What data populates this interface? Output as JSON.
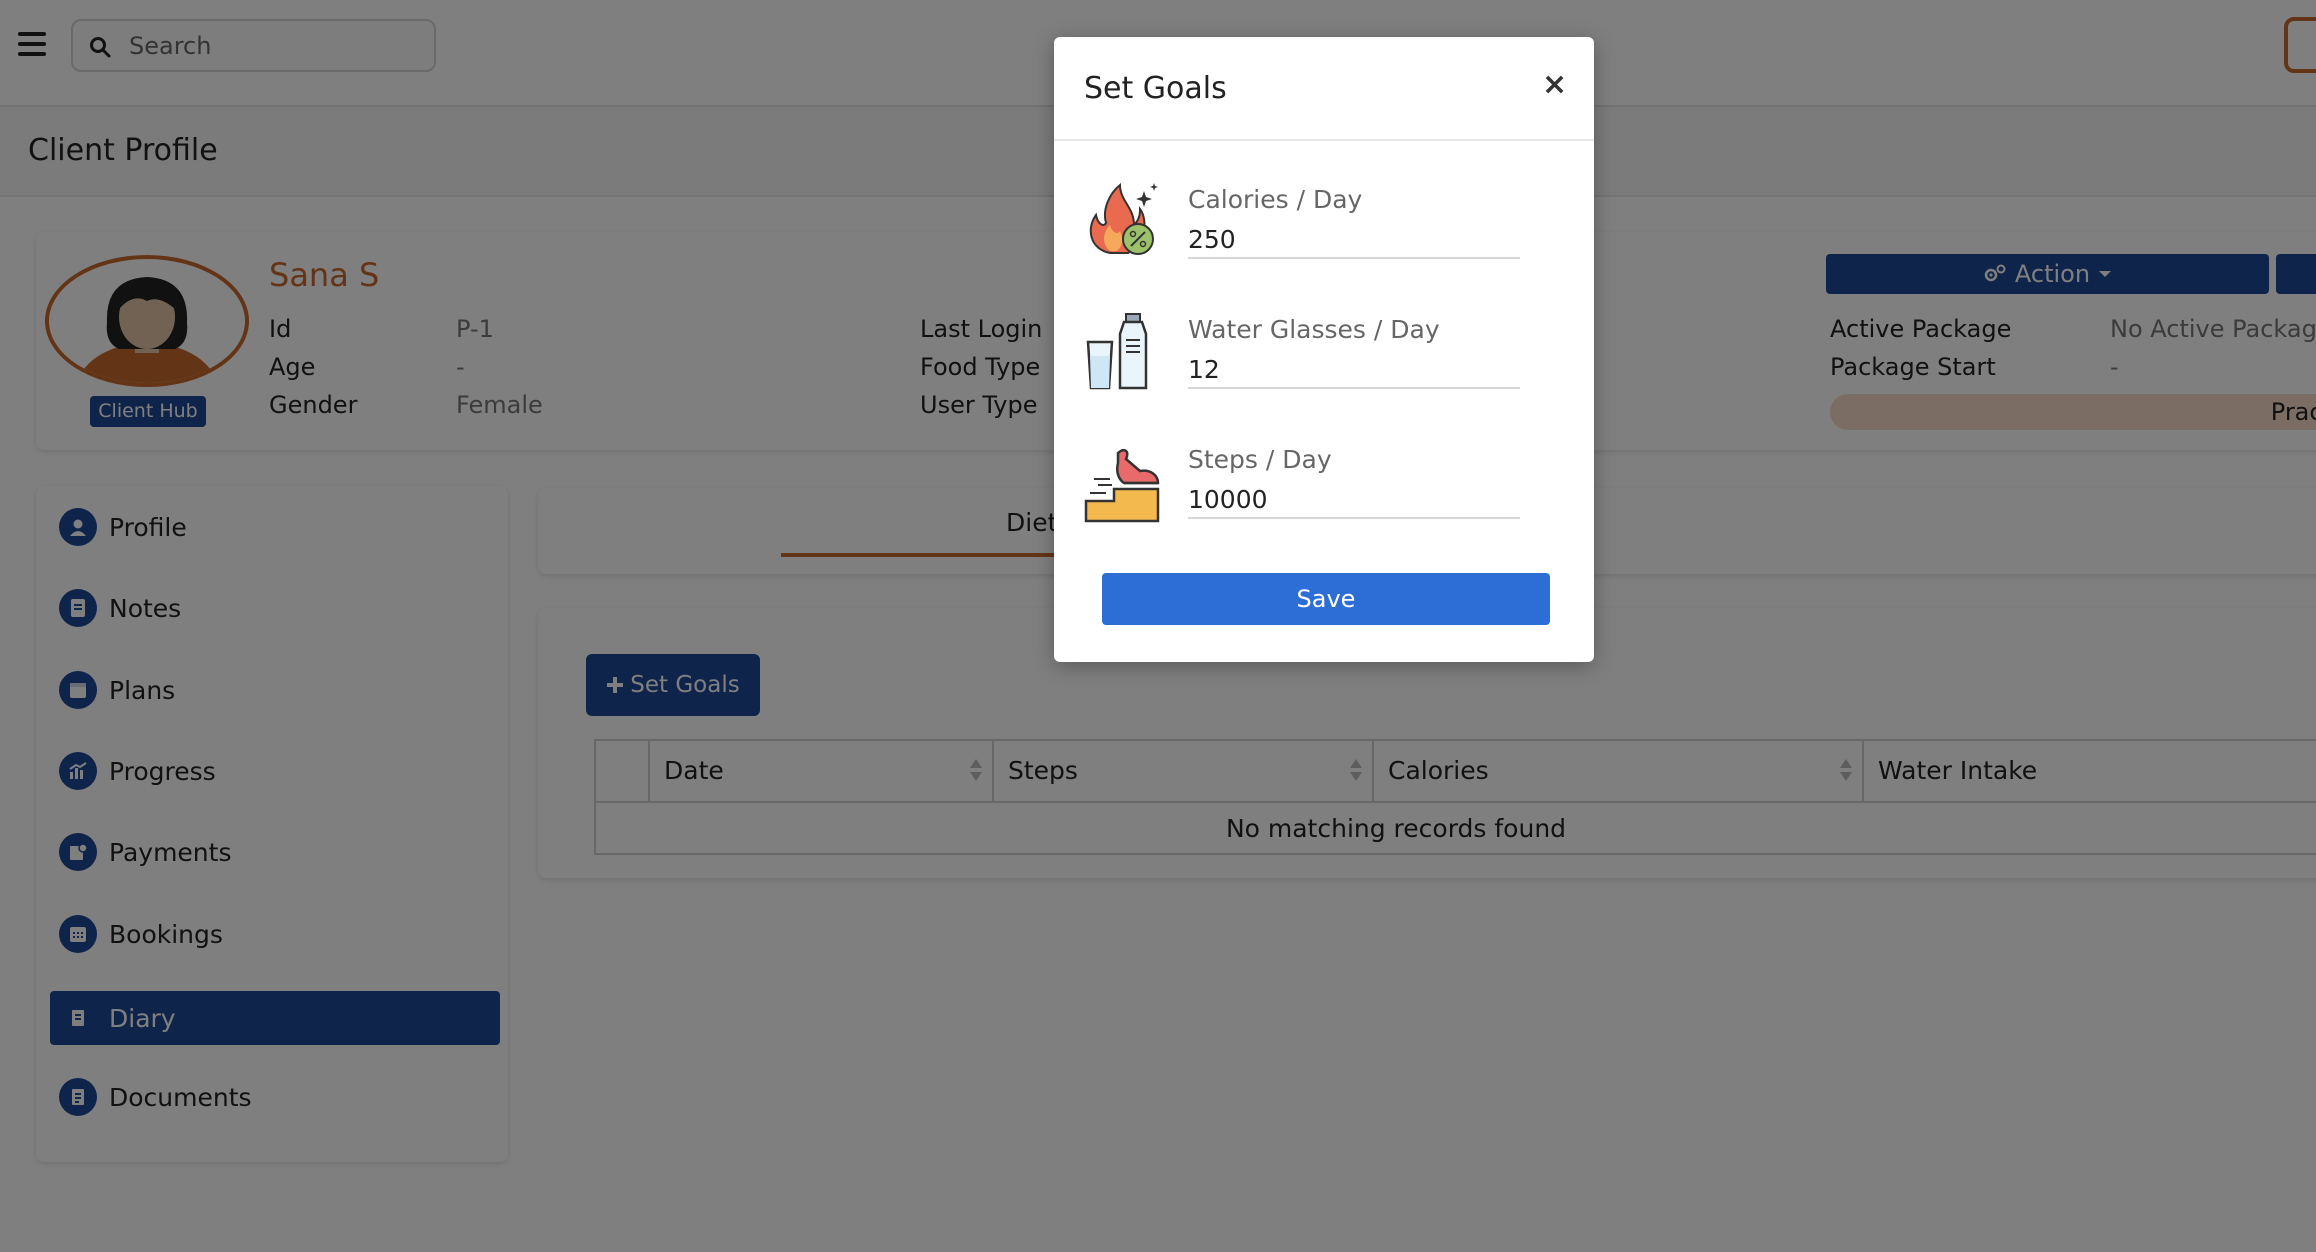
{
  "search": {
    "placeholder": "Search"
  },
  "page": {
    "title": "Client Profile"
  },
  "client": {
    "name": "Sana S",
    "badge": "Client Hub",
    "fields": [
      {
        "label": "Id",
        "value": "P-1"
      },
      {
        "label": "Age",
        "value": "-"
      },
      {
        "label": "Gender",
        "value": "Female"
      }
    ],
    "middle_labels": [
      "Last Login",
      "Food Type",
      "User Type"
    ],
    "action_label": "Action",
    "package": [
      {
        "label": "Active Package",
        "value": "No Active Packag"
      },
      {
        "label": "Package Start",
        "value": "-"
      }
    ],
    "practitioner_label": "Pract"
  },
  "sidebar": {
    "items": [
      {
        "label": "Profile",
        "icon": "user-icon"
      },
      {
        "label": "Notes",
        "icon": "notes-icon"
      },
      {
        "label": "Plans",
        "icon": "plans-icon"
      },
      {
        "label": "Progress",
        "icon": "progress-icon"
      },
      {
        "label": "Payments",
        "icon": "payments-icon"
      },
      {
        "label": "Bookings",
        "icon": "calendar-icon"
      },
      {
        "label": "Diary",
        "icon": "diary-icon",
        "active": true
      },
      {
        "label": "Documents",
        "icon": "documents-icon"
      }
    ]
  },
  "main": {
    "tab_label": "Diet",
    "set_goals_label": "Set Goals",
    "table": {
      "columns": [
        "Date",
        "Steps",
        "Calories",
        "Water Intake"
      ],
      "empty_message": "No matching records found"
    }
  },
  "modal": {
    "title": "Set Goals",
    "close": "×",
    "goals": [
      {
        "label": "Calories / Day",
        "value": "250",
        "icon": "calories-icon"
      },
      {
        "label": "Water Glasses / Day",
        "value": "12",
        "icon": "water-icon"
      },
      {
        "label": "Steps / Day",
        "value": "10000",
        "icon": "steps-icon"
      }
    ],
    "save_label": "Save"
  },
  "colors": {
    "primary": "#1e4896",
    "accent": "#c8692e",
    "save": "#2c6ed5"
  }
}
